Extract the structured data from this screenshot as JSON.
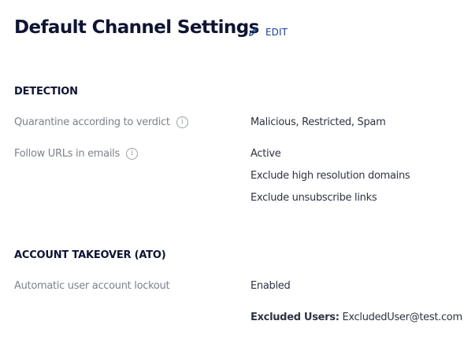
{
  "header": {
    "title": "Default Channel Settings",
    "edit_label": "EDIT"
  },
  "detection": {
    "title": "DETECTION",
    "quarantine_label": "Quarantine according to verdict",
    "quarantine_value": "Malicious, Restricted, Spam",
    "follow_urls_label": "Follow URLs in emails",
    "follow_urls_values": [
      "Active",
      "Exclude high resolution domains",
      "Exclude unsubscribe links"
    ]
  },
  "ato": {
    "title": "ACCOUNT TAKEOVER (ATO)",
    "lockout_label": "Automatic user account lockout",
    "lockout_value": "Enabled",
    "excluded_users_label": "Excluded Users:",
    "excluded_users_value": "ExcludedUser@test.com"
  },
  "icons": {
    "edit": "pencil-icon",
    "info": "info-icon"
  },
  "colors": {
    "title": "#0f1432",
    "link": "#1c3f94",
    "label": "#7d828c",
    "value": "#2f3441"
  }
}
